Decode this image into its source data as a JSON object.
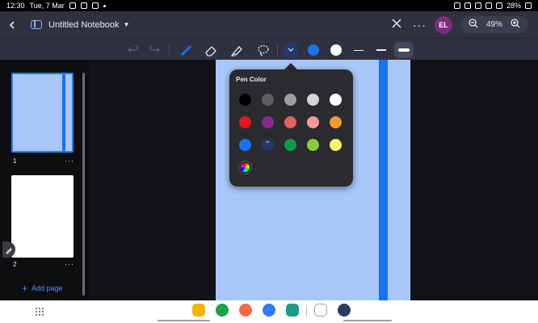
{
  "status_bar": {
    "time": "12:30",
    "date": "Tue, 7 Mar",
    "battery": "28%"
  },
  "header": {
    "title": "Untitled Notebook",
    "avatar_initials": "EL",
    "zoom": "49%"
  },
  "toolbar": {
    "tools": [
      "undo-icon",
      "redo-icon",
      "pen-icon",
      "eraser-icon",
      "highlighter-icon",
      "lasso-icon"
    ],
    "active_color": "#1673f2",
    "secondary_color": "#ffffff"
  },
  "sidebar": {
    "pages": [
      {
        "number": "1"
      },
      {
        "number": "2"
      }
    ],
    "add_page_label": "Add page"
  },
  "popup": {
    "title": "Pen Color",
    "colors": [
      "#000000",
      "#5f5f5f",
      "#9e9e9e",
      "#d6d6d6",
      "#ffffff",
      "#e8141c",
      "#8b2a8c",
      "#e85f5f",
      "#f29a9a",
      "#f29b2b",
      "#1673f2",
      "#24396a",
      "#0e9a4a",
      "#8fcb3b",
      "#f7f56e"
    ],
    "selected_index": 11
  },
  "taskbar": {
    "apps": [
      "apps-grid-icon",
      "files-icon",
      "phone-icon",
      "contacts-icon",
      "messages-icon",
      "calendar-icon",
      "notes-icon",
      "settings-icon"
    ]
  }
}
